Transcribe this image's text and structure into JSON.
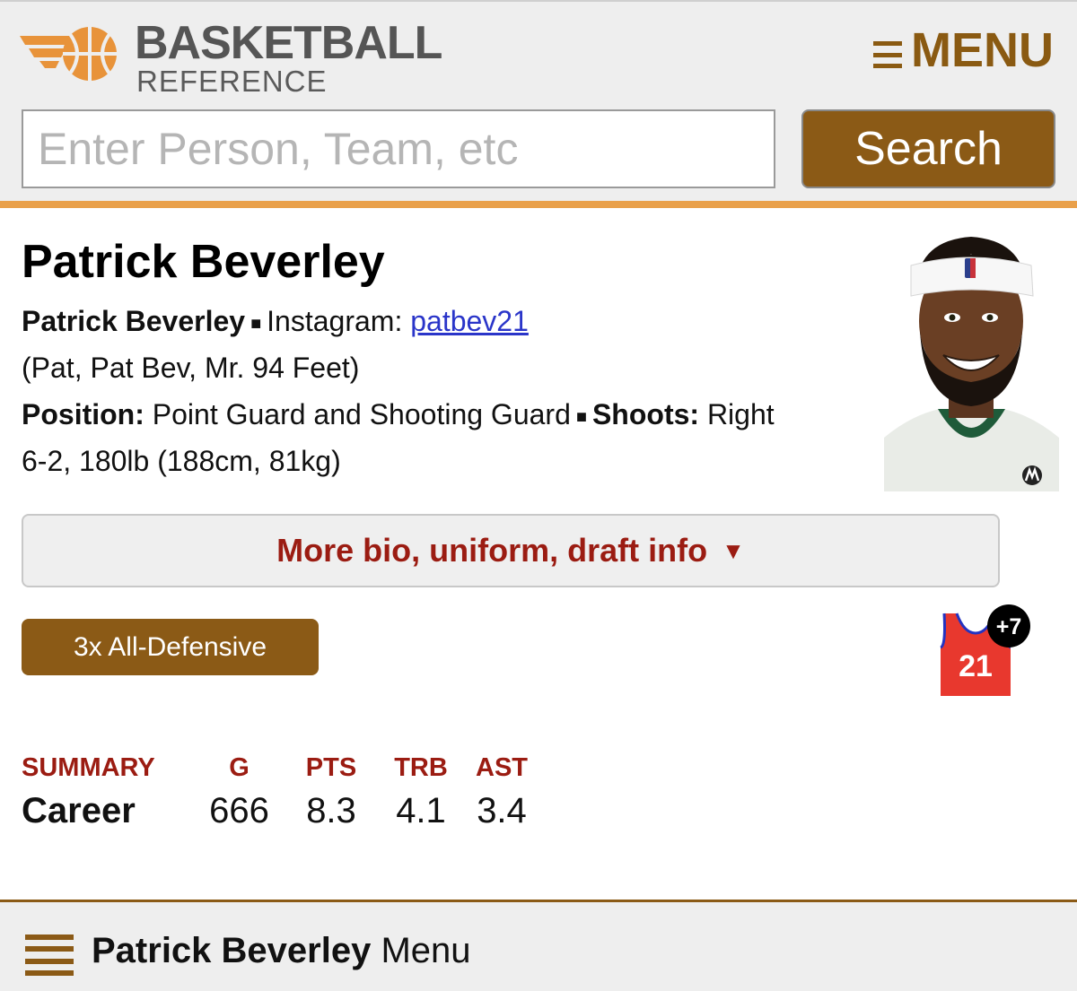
{
  "header": {
    "logo_top": "BASKETBALL",
    "logo_bottom": "REFERENCE",
    "menu_label": "MENU",
    "search_placeholder": "Enter Person, Team, etc",
    "search_button": "Search"
  },
  "player": {
    "name": "Patrick Beverley",
    "full_name": "Patrick Beverley",
    "instagram_label": "Instagram:",
    "instagram_handle": "patbev21",
    "nicknames": "(Pat, Pat Bev, Mr. 94 Feet)",
    "position_label": "Position:",
    "position_value": "Point Guard and Shooting Guard",
    "shoots_label": "Shoots:",
    "shoots_value": "Right",
    "size": "6-2, 180lb (188cm, 81kg)",
    "bio_button": "More bio, uniform, draft info",
    "bio_caret": "▼",
    "award": "3x All-Defensive",
    "jersey_number": "21",
    "jersey_more": "+7",
    "headshot_logo_text": "NBA"
  },
  "summary": {
    "headers": [
      "SUMMARY",
      "G",
      "PTS",
      "TRB",
      "AST"
    ],
    "career": [
      "Career",
      "666",
      "8.3",
      "4.1",
      "3.4"
    ]
  },
  "footer": {
    "name": "Patrick Beverley",
    "menu": "Menu"
  },
  "colors": {
    "brand_brown": "#8b5a16",
    "accent_orange": "#e9a04a",
    "link_blue": "#2a35c9",
    "stat_red": "#9b1c12",
    "jersey_red": "#e8382e"
  }
}
